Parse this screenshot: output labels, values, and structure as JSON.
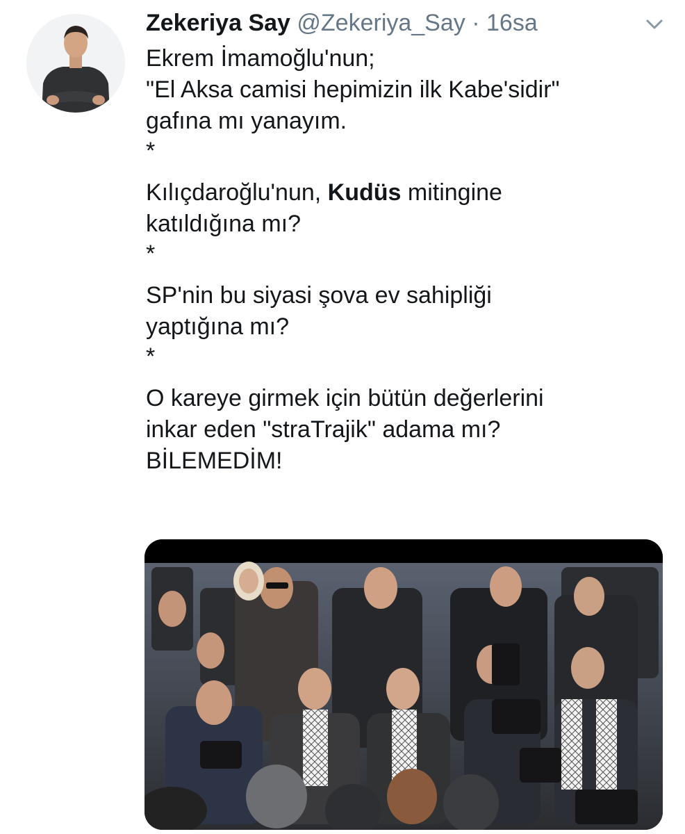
{
  "tweet": {
    "author_name": "Zekeriya Say",
    "author_handle": "@Zekeriya_Say",
    "separator": "·",
    "timestamp": "16sa",
    "menu_icon": "chevron-down-icon",
    "lines": {
      "l1": "Ekrem İmamoğlu'nun;",
      "l2": "\"El Aksa camisi hepimizin ilk Kabe'sidir\"",
      "l3": "gafına mı yanayım.",
      "s1": "*",
      "l4_pre": "Kılıçdaroğlu'nun, ",
      "l4_bold": "Kudüs",
      "l4_post": " mitingine",
      "l5": "katıldığına mı?",
      "s2": "*",
      "l6": "SP'nin bu siyasi şova ev sahipliği",
      "l7": "yaptığına mı?",
      "s3": "*",
      "l8": "O kareye girmek için bütün değerlerini",
      "l9": "inkar eden \"straTrajik\" adama mı?",
      "l10": "BİLEMEDİM!"
    },
    "media": {
      "kind": "photo",
      "description_icon": "crowd-photo"
    }
  },
  "colors": {
    "text": "#14171a",
    "secondary": "#657786",
    "background": "#ffffff"
  }
}
